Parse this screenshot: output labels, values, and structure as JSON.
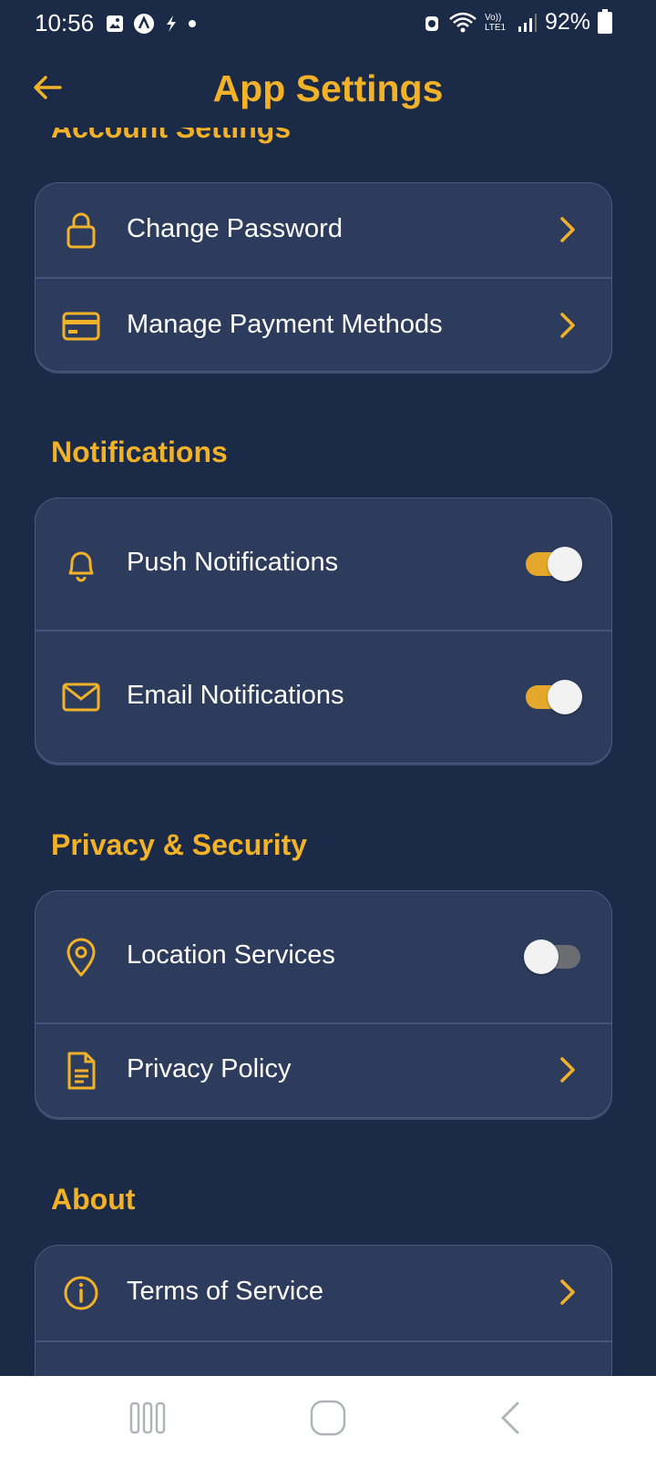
{
  "status_bar": {
    "time": "10:56",
    "battery": "92%",
    "left_icons": [
      "gallery-icon",
      "app-icon",
      "bolt-icon",
      "dot-icon"
    ],
    "right_icons": [
      "alarm-icon",
      "wifi-icon",
      "volte-lte-icon",
      "signal-icon",
      "battery-icon"
    ],
    "network_label": "Vo)) LTE1"
  },
  "header": {
    "title": "App Settings"
  },
  "sections": {
    "account": {
      "title": "Account Settings",
      "items": [
        {
          "label": "Change Password",
          "icon": "lock-icon",
          "control": "chevron"
        },
        {
          "label": "Manage Payment Methods",
          "icon": "credit-card-icon",
          "control": "chevron"
        }
      ]
    },
    "notifications": {
      "title": "Notifications",
      "items": [
        {
          "label": "Push Notifications",
          "icon": "bell-icon",
          "control": "toggle",
          "enabled": true
        },
        {
          "label": "Email Notifications",
          "icon": "mail-icon",
          "control": "toggle",
          "enabled": true
        }
      ]
    },
    "privacy": {
      "title": "Privacy & Security",
      "items": [
        {
          "label": "Location Services",
          "icon": "location-pin-icon",
          "control": "toggle",
          "enabled": false
        },
        {
          "label": "Privacy Policy",
          "icon": "document-icon",
          "control": "chevron"
        }
      ]
    },
    "about": {
      "title": "About",
      "items": [
        {
          "label": "Terms of Service",
          "icon": "info-icon",
          "control": "chevron"
        }
      ]
    }
  },
  "nav_bar": {
    "items": [
      "recent-apps-icon",
      "home-icon",
      "back-icon"
    ]
  },
  "colors": {
    "background": "#1b2a47",
    "card": "#2d3c5c",
    "accent": "#f1b22a",
    "toggle_on": "#e3a82b",
    "toggle_off": "#6a6d72"
  }
}
